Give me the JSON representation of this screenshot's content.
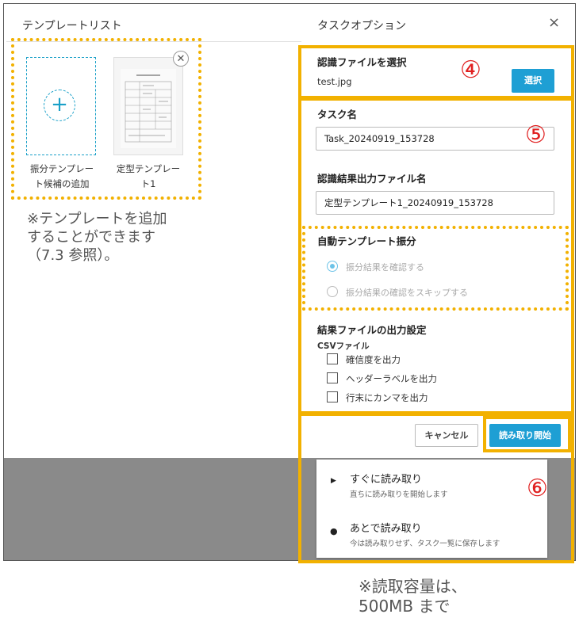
{
  "left_panel": {
    "title": "テンプレートリスト",
    "add_card": {
      "plus_symbol": "+",
      "label_line1": "振分テンプレー",
      "label_line2": "ト候補の追加"
    },
    "template_card": {
      "label_line1": "定型テンプレー",
      "label_line2": "ト1",
      "close_symbol": "✕"
    }
  },
  "note_templates": {
    "line1": "※テンプレートを追加",
    "line2": "することができます",
    "line3": "（7.3 参照）。"
  },
  "right_panel": {
    "title": "タスクオプション",
    "close_symbol": "×",
    "file_section": {
      "title": "認識ファイルを選択",
      "file_name": "test.jpg",
      "select_button": "選択"
    },
    "task_name": {
      "label": "タスク名",
      "value": "Task_20240919_153728"
    },
    "output_file": {
      "label": "認識結果出力ファイル名",
      "value": "定型テンプレート1_20240919_153728"
    },
    "auto_sort": {
      "title": "自動テンプレート振分",
      "options": [
        {
          "label": "振分結果を確認する",
          "selected": true
        },
        {
          "label": "振分結果の確認をスキップする",
          "selected": false
        }
      ]
    },
    "result_output": {
      "title": "結果ファイルの出力設定",
      "sub_title": "CSVファイル",
      "checkboxes": [
        {
          "label": "確信度を出力",
          "checked": false
        },
        {
          "label": "ヘッダーラベルを出力",
          "checked": false
        },
        {
          "label": "行末にカンマを出力",
          "checked": false
        }
      ]
    },
    "footer": {
      "cancel_button": "キャンセル",
      "start_button": "読み取り開始"
    }
  },
  "dropdown": {
    "items": [
      {
        "icon": "play-icon",
        "glyph": "▶",
        "title": "すぐに読み取り",
        "description": "直ちに読み取りを開始します"
      },
      {
        "icon": "clock-icon",
        "glyph": "●",
        "title": "あとで読み取り",
        "description": "今は読み取りせず、タスク一覧に保存します"
      }
    ]
  },
  "annotations": {
    "num4": "④",
    "num5": "⑤",
    "num6": "⑥"
  },
  "note_capacity": {
    "line1": "※読取容量は、",
    "line2": "500MB まで"
  },
  "colors": {
    "annotation": "#f2b100",
    "accent": "#1e9fd4",
    "annotation_number": "#e02020"
  }
}
